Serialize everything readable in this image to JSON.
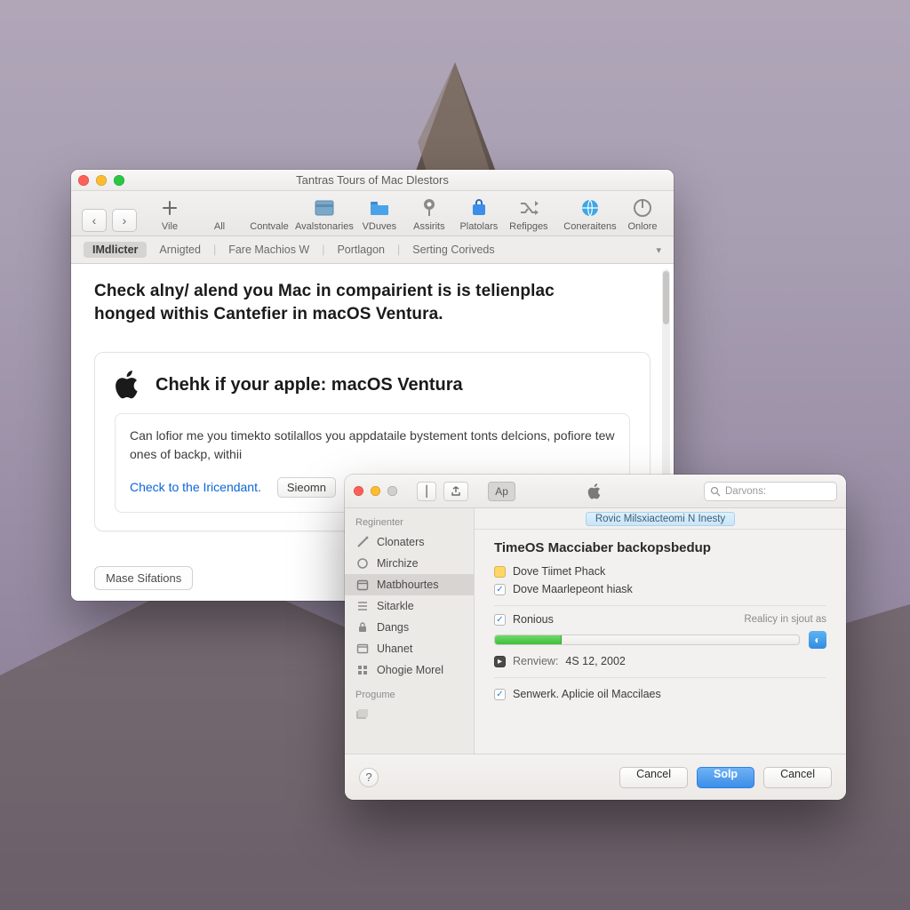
{
  "browser": {
    "title": "Tantras Tours of Mac Dlestors",
    "toolbar": {
      "items": [
        {
          "label": "Vile"
        },
        {
          "label": "All"
        },
        {
          "label": "Contvale"
        },
        {
          "label": "Avalstonaries"
        },
        {
          "label": "VDuves"
        },
        {
          "label": "Assirits"
        },
        {
          "label": "Platolars"
        },
        {
          "label": "Refipges"
        },
        {
          "label": "Coneraitens"
        },
        {
          "label": "Onlore"
        }
      ]
    },
    "tabs": {
      "active": "IMdlicter",
      "items": [
        "Arnigted",
        "Fare Machios W",
        "Portlagon",
        "Serting Coriveds"
      ]
    },
    "content": {
      "headline": "Check alny/ alend you Mac in compairient is is telienplac honged withis Cantefier in macOS Ventura.",
      "card_title": "Chehk if your apple: macOS Ventura",
      "body": "Can lofior me you timekto sotilallos you appdataile bystement tonts delcions, pofiore tew ones of backp, withii",
      "link": "Check to the Iricendant.",
      "secondary_button": "Sieomn",
      "bottom_pill": "Mase Sifations"
    }
  },
  "dialog": {
    "search_placeholder": "Darvons:",
    "toolbar_pill": "Ap",
    "crumb": "Rovic Milsxiacteomi N Inesty",
    "sidebar": {
      "header1": "Reginenter",
      "header2": "Progume",
      "items": [
        {
          "label": "Clonaters"
        },
        {
          "label": "Mirchize"
        },
        {
          "label": "Matbhourtes"
        },
        {
          "label": "Sitarkle"
        },
        {
          "label": "Dangs"
        },
        {
          "label": "Uhanet"
        },
        {
          "label": "Ohogie Morel"
        }
      ]
    },
    "panel": {
      "title": "TimeOS Macciaber backopsbedup",
      "opt1": "Dove Tiimet Phack",
      "opt2": "Dove Maarlepeont hiask",
      "status_left": "Ronious",
      "status_right": "Realicy in sjout as",
      "review_label": "Renview:",
      "review_value": "4S 12, 2002",
      "senwerk": "Senwerk.  Aplicie oil Maccilaes"
    },
    "footer": {
      "cancel1": "Cancel",
      "primary": "Solp",
      "cancel2": "Cancel"
    }
  },
  "colors": {
    "accent_blue": "#3b8ee9",
    "link_blue": "#0a66d6",
    "progress_green": "#3fbf3a"
  }
}
